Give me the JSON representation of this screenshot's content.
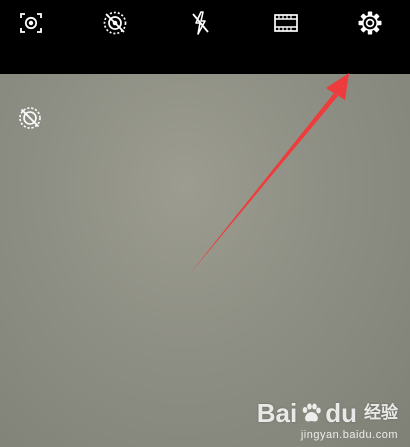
{
  "toolbar": {
    "buttons": [
      {
        "name": "scene-detect-button",
        "icon": "scene-detect-icon"
      },
      {
        "name": "live-photo-button",
        "icon": "live-photo-off-icon"
      },
      {
        "name": "flash-button",
        "icon": "flash-off-icon"
      },
      {
        "name": "aspect-ratio-button",
        "icon": "film-frame-icon"
      },
      {
        "name": "settings-button",
        "icon": "gear-icon"
      }
    ]
  },
  "viewfinder": {
    "overlay_button_icon": "ai-off-icon"
  },
  "annotation": {
    "arrow_color": "#ee3b3b",
    "points_to": "settings-button"
  },
  "watermark": {
    "brand_a": "Bai",
    "brand_b": "du",
    "sub": "经验",
    "url": "jingyan.baidu.com"
  }
}
